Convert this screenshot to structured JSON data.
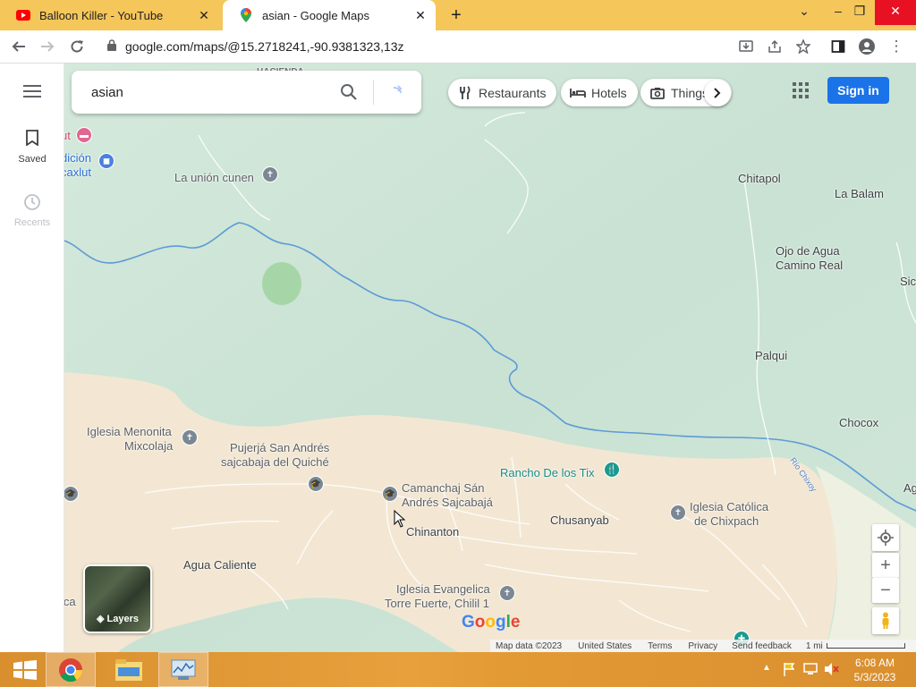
{
  "browser": {
    "tabs": [
      {
        "title": "Balloon Killer - YouTube",
        "active": false
      },
      {
        "title": "asian - Google Maps",
        "active": true
      }
    ],
    "url": "google.com/maps/@15.2718241,-90.9381323,13z"
  },
  "rail": {
    "saved_label": "Saved",
    "recents_label": "Recents"
  },
  "search": {
    "query": "asian"
  },
  "chips": [
    {
      "label": "Restaurants",
      "icon": "fork-knife-icon"
    },
    {
      "label": "Hotels",
      "icon": "bed-icon"
    },
    {
      "label": "Things",
      "icon": "camera-icon"
    }
  ],
  "header": {
    "signin_label": "Sign in"
  },
  "map": {
    "labels": {
      "hacienda": "HACIENDA",
      "la_union_cunen": "La unión cunen",
      "chitapol": "Chitapol",
      "la_balam": "La Balam",
      "ojo_de_agua_1": "Ojo de Agua",
      "ojo_de_agua_2": "Camino Real",
      "sic": "Sic",
      "palqui": "Palqui",
      "chocox": "Chocox",
      "ag": "Ag",
      "rio_chixoy": "Río Chixoy",
      "iglesia_menonita_1": "Iglesia Menonita",
      "iglesia_menonita_2": "Mixcolaja",
      "pujerja_1": "Pujerjá San Andrés",
      "pujerja_2": "sajcabaja del Quiché",
      "rancho": "Rancho De los Tix",
      "camanchaj_1": "Camanchaj Sán",
      "camanchaj_2": "Andrés Sajcabajá",
      "chusanyab": "Chusanyab",
      "iglesia_catolica_1": "Iglesia Católica",
      "iglesia_catolica_2": "de Chixpach",
      "chinanton": "Chinanton",
      "agua_caliente": "Agua Caliente",
      "iglesia_evangelica_1": "Iglesia Evangelica",
      "iglesia_evangelica_2": "Torre Fuerte, Chilil 1",
      "edge_ut": "ut",
      "edge_dicion": "dición",
      "edge_caxlut": "caxlut",
      "edica": "ica"
    },
    "layers_label": "Layers",
    "logo": "Google"
  },
  "footer": {
    "map_data": "Map data ©2023",
    "country": "United States",
    "terms": "Terms",
    "privacy": "Privacy",
    "feedback": "Send feedback",
    "scale": "1 mi"
  },
  "taskbar": {
    "time": "6:08 AM",
    "date": "5/3/2023"
  },
  "colors": {
    "tabbar": "#f5c65a",
    "map_forest": "#cfe5d8",
    "map_land": "#f3e7d3",
    "river": "#5c9ad6",
    "signin": "#1a73e8",
    "taskbar": "#e39a35"
  }
}
